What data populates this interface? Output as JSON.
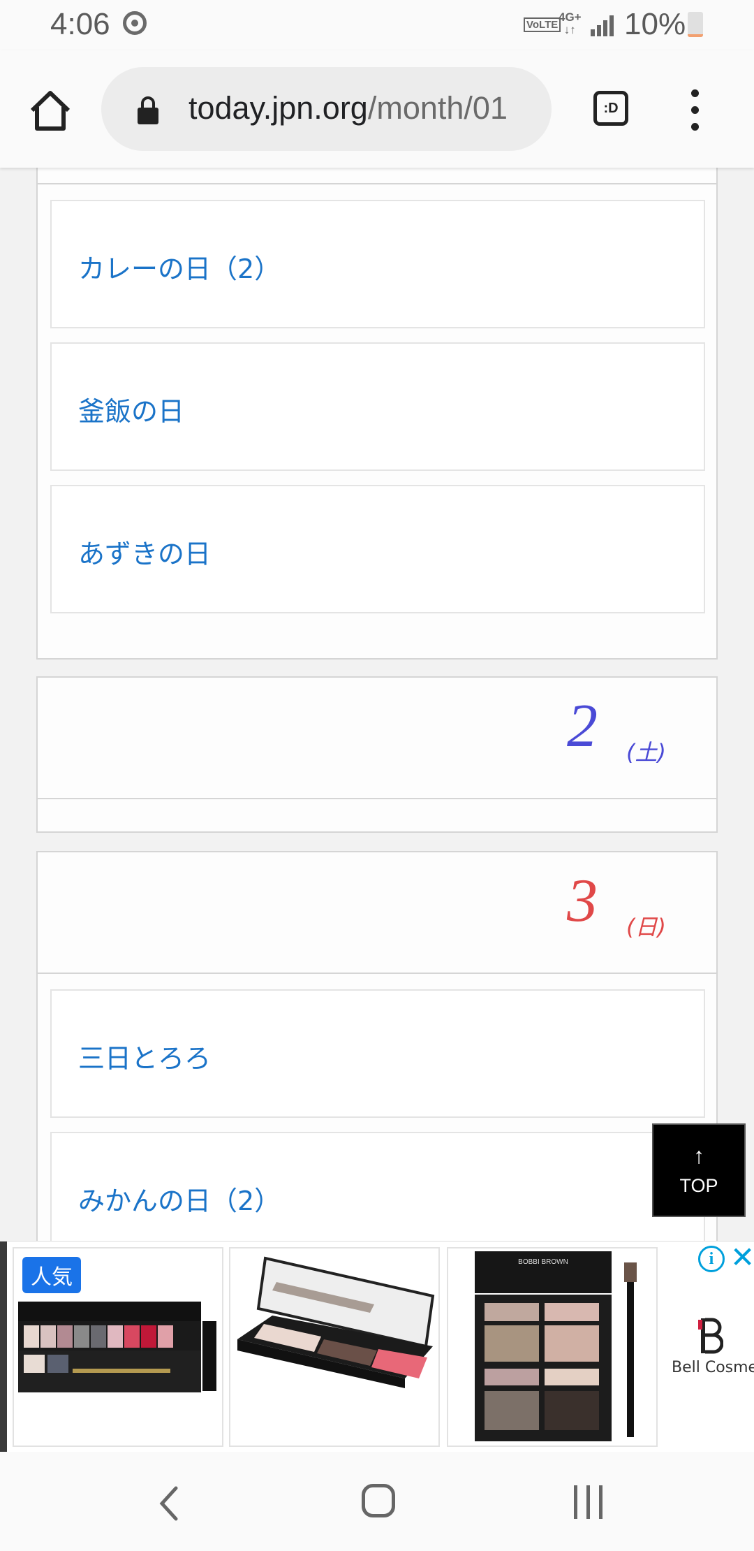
{
  "status_bar": {
    "time": "4:06",
    "volte": "VoLTE",
    "network_top": "4G+",
    "network_bottom": "↓↑",
    "battery": "10%",
    "battery_level": 0.1
  },
  "browser": {
    "url_host": "today.jpn.org",
    "url_path": "/month/01",
    "tab_label": ":D"
  },
  "days": [
    {
      "day": "",
      "weekday": "",
      "items": [
        "カレーの日（2）",
        "釜飯の日",
        "あずきの日"
      ]
    },
    {
      "day": "2",
      "weekday": "(土)",
      "color": "#4a4ad6",
      "items": []
    },
    {
      "day": "3",
      "weekday": "(日)",
      "color": "#e04848",
      "items": [
        "三日とろろ",
        "みかんの日（2）"
      ]
    }
  ],
  "top_button": {
    "arrow": "↑",
    "label": "TOP"
  },
  "ad": {
    "badge": "人気",
    "info": "i",
    "close": "✕",
    "advertiser": "Bell Cosme",
    "card3_brand": "BOBBI BROWN",
    "products": [
      "eyeshadow-lip-palette",
      "open-makeup-palette",
      "eyeshadow-quad-with-brush"
    ]
  },
  "icons": {
    "home": "home-icon",
    "lock": "lock-icon",
    "tabs": "tab-switcher-icon",
    "menu": "more-vert-icon"
  }
}
